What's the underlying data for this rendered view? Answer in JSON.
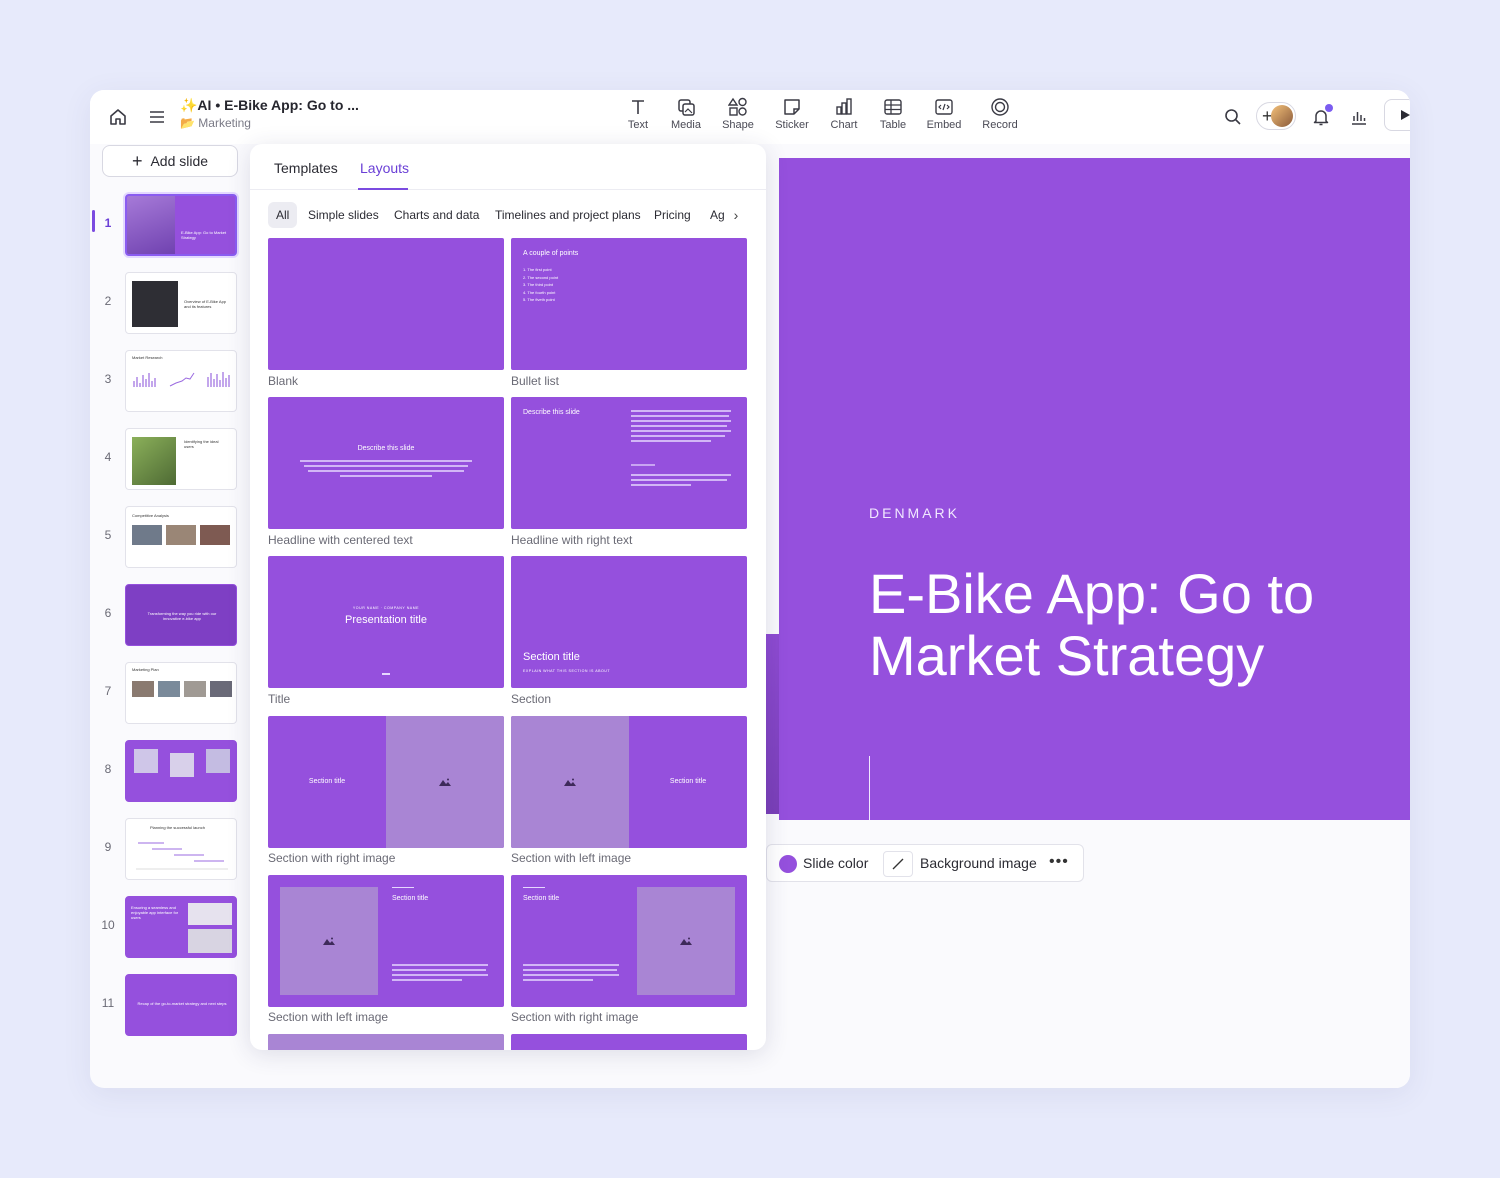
{
  "topbar": {
    "doc_title": "✨AI • E-Bike App: Go to ...",
    "doc_sub": "📂 Marketing",
    "tools": [
      {
        "label": "Text",
        "icon": "text-icon"
      },
      {
        "label": "Media",
        "icon": "media-icon"
      },
      {
        "label": "Shape",
        "icon": "shape-icon"
      },
      {
        "label": "Sticker",
        "icon": "sticker-icon"
      },
      {
        "label": "Chart",
        "icon": "chart-icon"
      },
      {
        "label": "Table",
        "icon": "table-icon"
      },
      {
        "label": "Embed",
        "icon": "embed-icon"
      },
      {
        "label": "Record",
        "icon": "record-icon"
      }
    ]
  },
  "sidebar": {
    "add_slide": "Add slide",
    "slides": [
      {
        "num": "1",
        "text": "E-Bike App: Go to Market Strategy"
      },
      {
        "num": "2",
        "text": "Overview of E-Bike App and its features"
      },
      {
        "num": "3",
        "text": "Market Research"
      },
      {
        "num": "4",
        "text": "Identifying the ideal users"
      },
      {
        "num": "5",
        "text": "Competitive Analysis"
      },
      {
        "num": "6",
        "text": "Transforming the way you ride with our innovative e-bike app"
      },
      {
        "num": "7",
        "text": "Marketing Plan"
      },
      {
        "num": "8",
        "text": ""
      },
      {
        "num": "9",
        "text": "Planning the successful launch"
      },
      {
        "num": "10",
        "text": "Ensuring a seamless and enjoyable app interface for users"
      },
      {
        "num": "11",
        "text": "Recap of the go-to-market strategy and next steps"
      }
    ]
  },
  "panel": {
    "tabs": [
      "Templates",
      "Layouts"
    ],
    "chips": [
      "All",
      "Simple slides",
      "Charts and data",
      "Timelines and project plans",
      "Pricing",
      "Ag"
    ],
    "layouts": [
      {
        "label": "Blank"
      },
      {
        "label": "Bullet list",
        "title": "A couple of points",
        "bullets": [
          "1. The first point",
          "2. The second point",
          "3. The third point",
          "4. The fourth point",
          "5. The fiveth point"
        ]
      },
      {
        "label": "Headline with centered text",
        "title": "Describe this slide"
      },
      {
        "label": "Headline with right text",
        "title": "Describe this slide"
      },
      {
        "label": "Title",
        "kicker": "YOUR NAME · COMPANY NAME",
        "title": "Presentation title"
      },
      {
        "label": "Section",
        "title": "Section title",
        "sub": "EXPLAIN WHAT THIS SECTION IS ABOUT"
      },
      {
        "label": "Section with right image",
        "title": "Section title"
      },
      {
        "label": "Section with left image",
        "title": "Section title"
      },
      {
        "label": "Section with left image",
        "title": "Section title"
      },
      {
        "label": "Section with right image",
        "title": "Section title"
      }
    ]
  },
  "slide": {
    "subtitle": "DENMARK",
    "title": "E-Bike App: Go to Market Strategy",
    "accent_color": "#9550dd"
  },
  "background_bar": {
    "slide_color": "Slide color",
    "background_image": "Background image",
    "more": "•••"
  }
}
